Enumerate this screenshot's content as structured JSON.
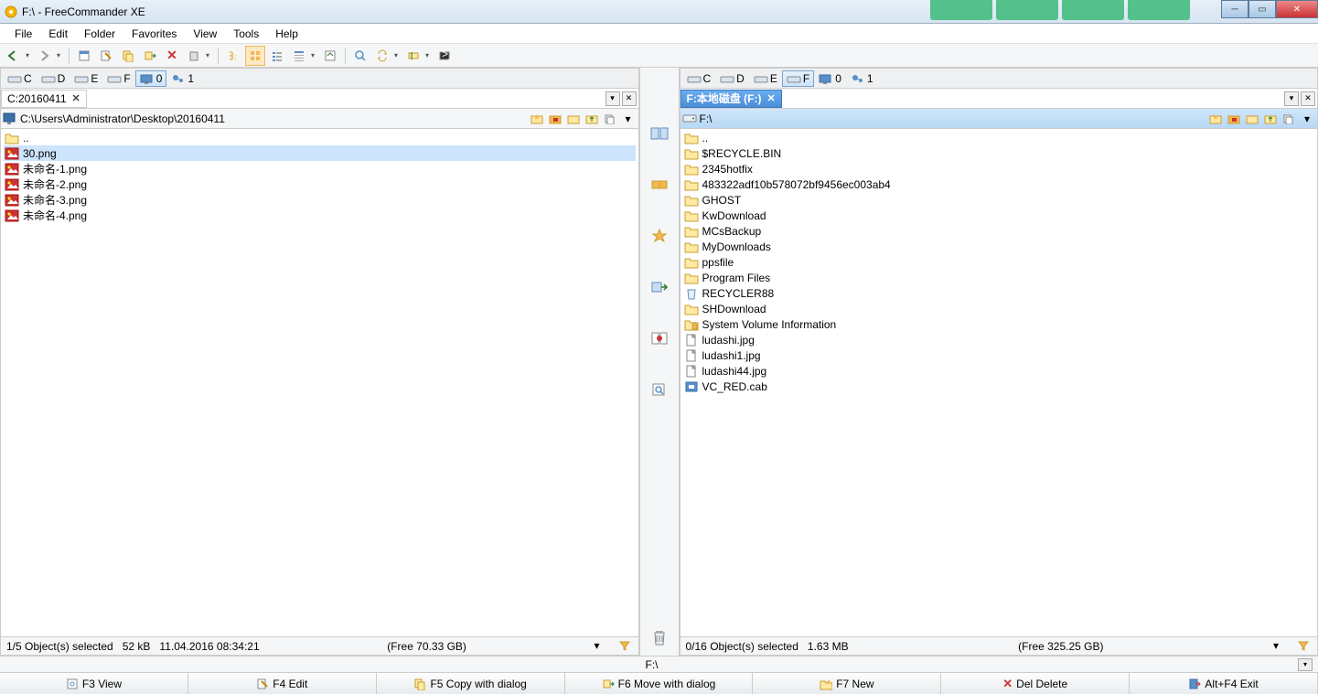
{
  "window": {
    "title": "F:\\ - FreeCommander XE"
  },
  "menu": {
    "file": "File",
    "edit": "Edit",
    "folder": "Folder",
    "favorites": "Favorites",
    "view": "View",
    "tools": "Tools",
    "help": "Help"
  },
  "drives": {
    "left": [
      {
        "label": "C"
      },
      {
        "label": "D"
      },
      {
        "label": "E"
      },
      {
        "label": "F"
      },
      {
        "label": "0"
      },
      {
        "label": "1"
      }
    ],
    "right": [
      {
        "label": "C"
      },
      {
        "label": "D"
      },
      {
        "label": "E"
      },
      {
        "label": "F"
      },
      {
        "label": "0"
      },
      {
        "label": "1"
      }
    ]
  },
  "leftPane": {
    "tab": "C:20160411",
    "path": "C:\\Users\\Administrator\\Desktop\\20160411",
    "parent": "..",
    "files": [
      {
        "name": "30.png",
        "type": "image"
      },
      {
        "name": "未命名-1.png",
        "type": "image"
      },
      {
        "name": "未命名-2.png",
        "type": "image"
      },
      {
        "name": "未命名-3.png",
        "type": "image"
      },
      {
        "name": "未命名-4.png",
        "type": "image"
      }
    ],
    "status": {
      "sel": "1/5 Object(s) selected",
      "size": "52 kB",
      "date": "11.04.2016 08:34:21",
      "free": "(Free 70.33 GB)"
    }
  },
  "rightPane": {
    "tab": "F:本地磁盘 (F:)",
    "path": "F:\\",
    "parent": "..",
    "files": [
      {
        "name": "$RECYCLE.BIN",
        "type": "folder"
      },
      {
        "name": "2345hotfix",
        "type": "folder"
      },
      {
        "name": "483322adf10b578072bf9456ec003ab4",
        "type": "folder"
      },
      {
        "name": "GHOST",
        "type": "folder"
      },
      {
        "name": "KwDownload",
        "type": "folder"
      },
      {
        "name": "MCsBackup",
        "type": "folder"
      },
      {
        "name": "MyDownloads",
        "type": "folder"
      },
      {
        "name": "ppsfile",
        "type": "folder"
      },
      {
        "name": "Program Files",
        "type": "folder"
      },
      {
        "name": "RECYCLER88",
        "type": "recycle"
      },
      {
        "name": "SHDownload",
        "type": "folder"
      },
      {
        "name": "System Volume Information",
        "type": "locked"
      },
      {
        "name": "ludashi.jpg",
        "type": "file"
      },
      {
        "name": "ludashi1.jpg",
        "type": "file"
      },
      {
        "name": "ludashi44.jpg",
        "type": "file"
      },
      {
        "name": "VC_RED.cab",
        "type": "cab"
      }
    ],
    "status": {
      "sel": "0/16 Object(s) selected",
      "size": "1.63 MB",
      "free": "(Free 325.25 GB)"
    }
  },
  "bottomPath": "F:\\",
  "fnbar": {
    "f3": "F3 View",
    "f4": "F4 Edit",
    "f5": "F5 Copy with dialog",
    "f6": "F6 Move with dialog",
    "f7": "F7 New",
    "del": "Del Delete",
    "exit": "Alt+F4 Exit"
  }
}
